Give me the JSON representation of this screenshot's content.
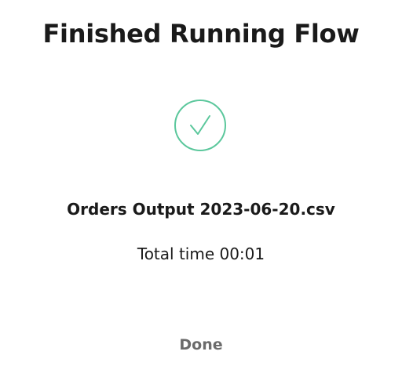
{
  "dialog": {
    "title": "Finished Running Flow",
    "status_icon": "check-circle-icon",
    "accent_color": "#5bc79c",
    "file_name": "Orders Output 2023-06-20.csv",
    "total_time": "Total time 00:01",
    "done_label": "Done"
  }
}
